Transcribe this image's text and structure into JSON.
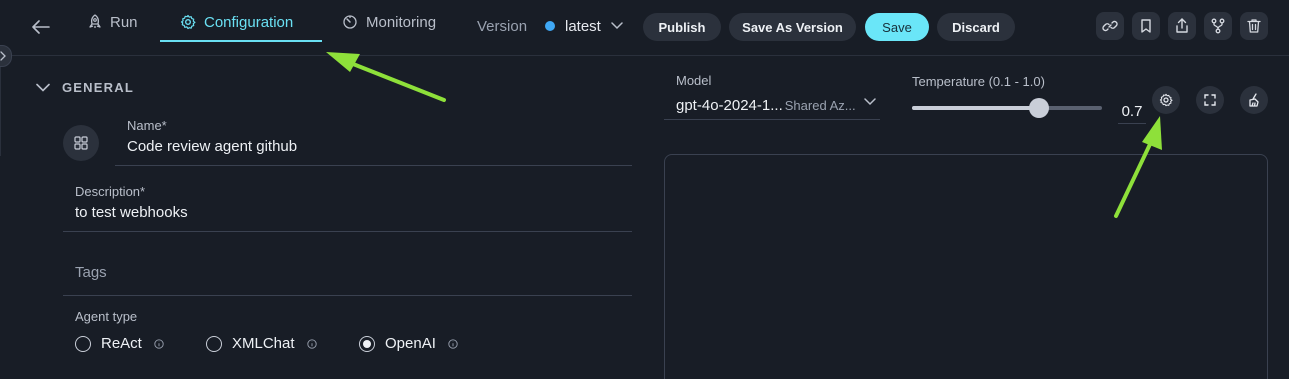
{
  "header": {
    "tabs": [
      {
        "label": "Run",
        "icon": "rocket-icon"
      },
      {
        "label": "Configuration",
        "icon": "gear-icon",
        "active": true
      },
      {
        "label": "Monitoring",
        "icon": "gauge-icon"
      }
    ],
    "version_label": "Version",
    "version_value": "latest",
    "buttons": {
      "publish": "Publish",
      "save_as_version": "Save As Version",
      "save": "Save",
      "discard": "Discard"
    },
    "icon_buttons": [
      "link-icon",
      "bookmark-icon",
      "share-icon",
      "fork-icon",
      "trash-icon"
    ]
  },
  "general": {
    "section_title": "GENERAL",
    "name_label": "Name*",
    "name_value": "Code review agent github",
    "description_label": "Description*",
    "description_value": "to test webhooks",
    "tags_placeholder": "Tags",
    "agent_type_label": "Agent type",
    "agent_types": [
      {
        "label": "ReAct",
        "checked": false
      },
      {
        "label": "XMLChat",
        "checked": false
      },
      {
        "label": "OpenAI",
        "checked": true
      }
    ]
  },
  "model": {
    "label": "Model",
    "name": "gpt-4o-2024-1...",
    "provider": "Shared Az..."
  },
  "temperature": {
    "label": "Temperature (0.1 - 1.0)",
    "value": "0.7",
    "min": 0.1,
    "max": 1.0,
    "current": 0.7
  },
  "colors": {
    "accent": "#6ae0f3",
    "version_dot": "#3fa8f5",
    "annotation_arrow": "#8ee03a"
  }
}
